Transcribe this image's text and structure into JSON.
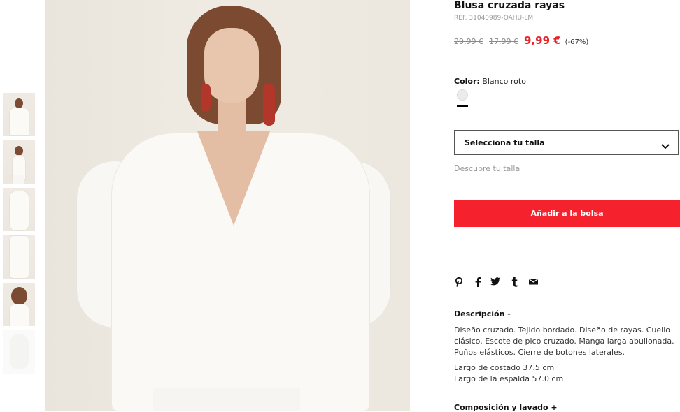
{
  "product": {
    "title": "Blusa cruzada rayas",
    "ref": "REF. 31040989-OAHU-LM",
    "prices": {
      "original": "29,99 €",
      "previous": "17,99 €",
      "sale": "9,99 €",
      "discount": "(-67%)"
    },
    "color": {
      "label": "Color:",
      "value": "Blanco roto",
      "swatch_hex": "#ebebea"
    },
    "size_select": {
      "placeholder": "Selecciona tu talla",
      "icon": "chevron-down-icon"
    },
    "size_guide_link": "Descubre tu talla",
    "add_to_bag": "Añadir a la bolsa",
    "accent_color": "#f5222e",
    "sale_price_color": "#e3242b",
    "share_icons": [
      "pinterest-icon",
      "facebook-icon",
      "twitter-icon",
      "tumblr-icon",
      "email-icon"
    ],
    "description": {
      "title": "Descripción -",
      "text": "Diseño cruzado. Tejido bordado. Diseño de rayas. Cuello clásico. Escote de pico cruzado. Manga larga abullonada. Puños elásticos. Cierre de botones laterales.",
      "measurements": [
        "Largo de costado 37.5 cm",
        "Largo de la espalda 57.0 cm"
      ]
    },
    "composition_title": "Composición y lavado +"
  },
  "gallery": {
    "thumbnail_count": 6,
    "selected_index": 0
  }
}
